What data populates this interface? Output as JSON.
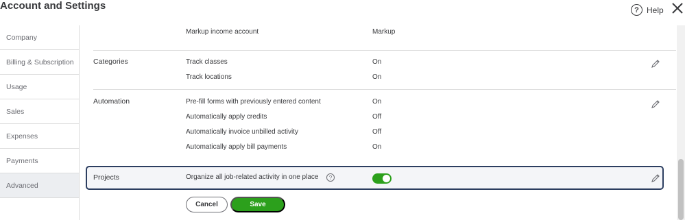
{
  "header": {
    "title": "Account and Settings",
    "help_label": "Help"
  },
  "sidebar": {
    "items": [
      {
        "label": "Company"
      },
      {
        "label": "Billing & Subscription"
      },
      {
        "label": "Usage"
      },
      {
        "label": "Sales"
      },
      {
        "label": "Expenses"
      },
      {
        "label": "Payments"
      },
      {
        "label": "Advanced",
        "active": true
      }
    ]
  },
  "main": {
    "markup": {
      "label": "Markup income account",
      "value": "Markup"
    },
    "categories": {
      "title": "Categories",
      "rows": [
        {
          "label": "Track classes",
          "value": "On"
        },
        {
          "label": "Track locations",
          "value": "On"
        }
      ]
    },
    "automation": {
      "title": "Automation",
      "rows": [
        {
          "label": "Pre-fill forms with previously entered content",
          "value": "On"
        },
        {
          "label": "Automatically apply credits",
          "value": "Off"
        },
        {
          "label": "Automatically invoice unbilled activity",
          "value": "Off"
        },
        {
          "label": "Automatically apply bill payments",
          "value": "On"
        }
      ]
    },
    "projects": {
      "title": "Projects",
      "label": "Organize all job-related activity in one place",
      "toggle_on": true
    },
    "buttons": {
      "cancel": "Cancel",
      "save": "Save"
    }
  },
  "colors": {
    "accent_green": "#2ca01c",
    "focus_border": "#2c3e60",
    "text": "#393a3d"
  },
  "icons": [
    "help-icon",
    "close-icon",
    "pencil-icon",
    "info-icon"
  ]
}
